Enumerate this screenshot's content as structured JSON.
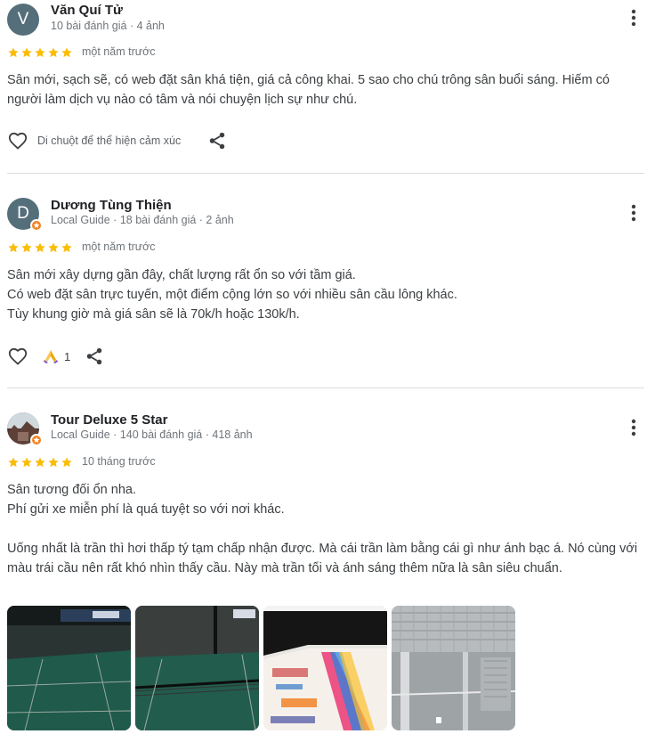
{
  "reviews": [
    {
      "avatar_letter": "V",
      "name": "Văn Quí Tử",
      "meta": "10 bài đánh giá · 4 ảnh",
      "rating": 5,
      "time": "một năm trước",
      "text": [
        "Sân mới, sạch sẽ, có web đặt sân khá tiện, giá cả công khai. 5 sao cho chú trông sân buổi sáng. Hiếm có người làm dịch vụ nào có tâm và nói chuyện lịch sự như chú."
      ],
      "reaction_hint": "Di chuột để thể hiện cảm xúc"
    },
    {
      "avatar_letter": "D",
      "name": "Dương Tùng Thiện",
      "meta": "Local Guide · 18 bài đánh giá · 2 ảnh",
      "rating": 5,
      "time": "một năm trước",
      "text": [
        "Sân mới xây dựng gần đây, chất lượng rất ổn so với tầm giá.",
        "Có web đặt sân trực tuyến, một điểm cộng lớn so với nhiều sân cầu lông khác.",
        "Tùy khung giờ mà giá sân sẽ là 70k/h hoặc 130k/h."
      ],
      "reaction_count": "1"
    },
    {
      "name": "Tour Deluxe 5 Star",
      "meta": "Local Guide · 140 bài đánh giá · 418 ảnh",
      "rating": 5,
      "time": "10 tháng trước",
      "text": [
        "Sân tương đối ổn nha.",
        "Phí gửi xe miễn phí là quá tuyệt so với nơi khác.",
        "",
        "Uống nhất là trần thì hơi thấp tý tạm chấp nhận được. Mà cái trần làm bằng cái gì như ánh bạc á. Nó cùng với màu trái cầu nên rất khó nhìn thấy cầu. Này mà trần tối và ánh sáng thêm nữa là sân siêu chuẩn."
      ],
      "photo_count": 4
    }
  ],
  "colors": {
    "star": "#fbbc04",
    "badge": "#f48120",
    "avatar_bg": "#546e7a",
    "divider": "#dadce0"
  },
  "icons": [
    "more-vert-icon",
    "star-icon",
    "heart-outline-icon",
    "share-icon",
    "praying-hands-icon",
    "local-guide-badge-icon"
  ]
}
